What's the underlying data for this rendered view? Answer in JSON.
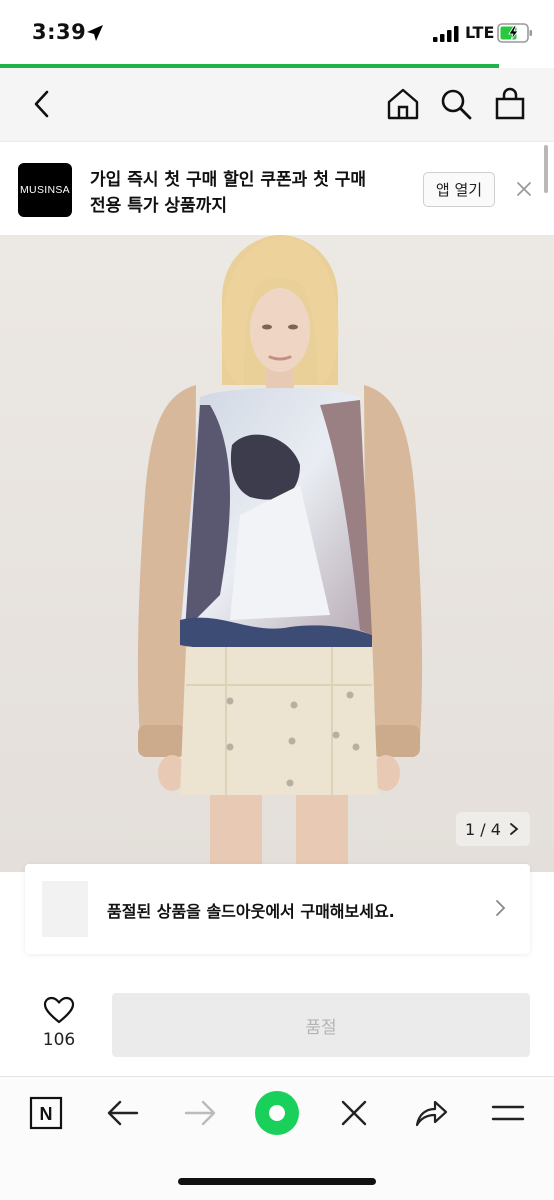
{
  "status_bar": {
    "time": "3:39",
    "carrier": "LTE",
    "load_progress": 0.9
  },
  "nav": {
    "icons": [
      "back-chevron-icon",
      "home-icon",
      "search-icon",
      "shopping-bag-icon"
    ]
  },
  "app_banner": {
    "logo_text": "MUSINSA",
    "line1": "가입 즉시 첫 구매 할인 쿠폰과 첫 구매",
    "line2": "전용 특가 상품까지",
    "open_app_label": "앱 열기"
  },
  "product_image": {
    "page_indicator": "1 / 4"
  },
  "soldout_notice": {
    "text": "품절된 상품을 솔드아웃에서 구매해보세요."
  },
  "purchase_bar": {
    "like_count": "106",
    "buy_label": "품절"
  },
  "browser_toolbar": {
    "naver_logo": "N",
    "icons": [
      "naver-home-icon",
      "back-arrow-icon",
      "forward-arrow-icon",
      "green-dot-icon",
      "close-icon",
      "share-icon",
      "menu-icon"
    ]
  },
  "colors": {
    "load_bar": "#20b24b",
    "green_button": "#1ec800",
    "logo_bg": "#000000",
    "disabled_button_bg": "#ebebeb"
  }
}
